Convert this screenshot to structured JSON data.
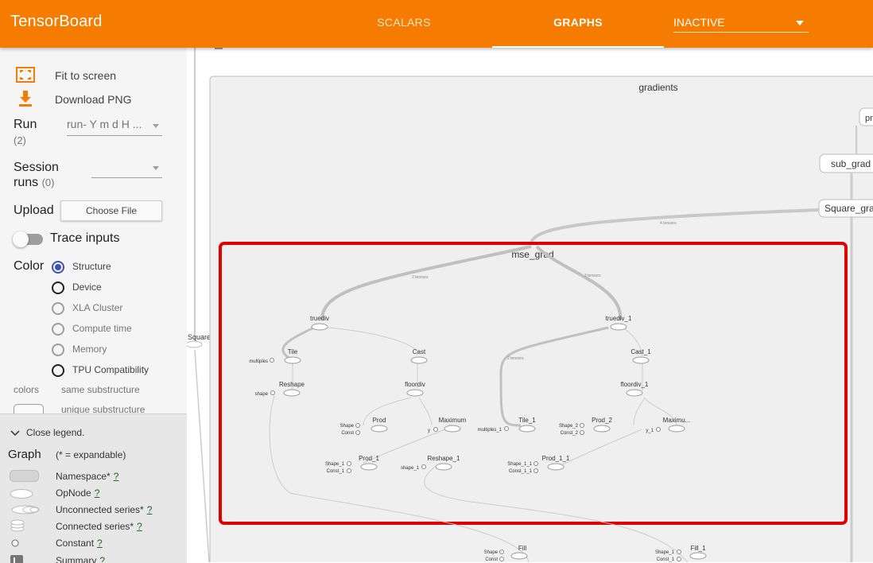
{
  "header": {
    "brand": "TensorBoard",
    "tabs": [
      {
        "label": "SCALARS",
        "active": false
      },
      {
        "label": "GRAPHS",
        "active": true
      }
    ],
    "run_selector": "INACTIVE"
  },
  "sidebar": {
    "fit_to_screen": "Fit to screen",
    "download_png": "Download PNG",
    "run_label": "Run",
    "run_count": "(2)",
    "run_value": "run- Y m d H ...",
    "session_label_1": "Session",
    "session_label_2": "runs",
    "session_count": "(0)",
    "upload_label": "Upload",
    "choose_file": "Choose File",
    "trace_inputs": "Trace inputs",
    "color_label": "Color",
    "color_options": [
      {
        "label": "Structure",
        "state": "selected"
      },
      {
        "label": "Device",
        "state": "enabled"
      },
      {
        "label": "XLA Cluster",
        "state": "disabled"
      },
      {
        "label": "Compute time",
        "state": "disabled"
      },
      {
        "label": "Memory",
        "state": "disabled"
      },
      {
        "label": "TPU Compatibility",
        "state": "enabled"
      }
    ],
    "colors_label": "colors",
    "same_substructure": "same substructure",
    "unique_substructure": "unique substructure"
  },
  "legend": {
    "close": "Close legend.",
    "graph_label": "Graph",
    "expandable_note": "(* = expandable)",
    "items": [
      {
        "label": "Namespace*",
        "help": "?"
      },
      {
        "label": "OpNode",
        "help": "?"
      },
      {
        "label": "Unconnected series*",
        "help": "?"
      },
      {
        "label": "Connected series*",
        "help": "?"
      },
      {
        "label": "Constant",
        "help": "?"
      },
      {
        "label": "Summary",
        "help": "?"
      }
    ]
  },
  "graph": {
    "namespace_title": "gradients",
    "highlight_title": "mse_grad",
    "square_label": "Square",
    "side_nodes": [
      "sub_grad",
      "Square_grad",
      "pre"
    ],
    "edge_labels": [
      "2 tensors",
      "4 tensors",
      "3 tensors",
      "2 tensors"
    ],
    "nodes": {
      "truediv": "truediv",
      "truediv_1": "truediv_1",
      "tile": "Tile",
      "cast": "Cast",
      "cast_1": "Cast_1",
      "reshape": "Reshape",
      "floordiv": "floordiv",
      "floordiv_1": "floordiv_1",
      "prod": "Prod",
      "maximum": "Maximum",
      "tile_1": "Tile_1",
      "prod_2": "Prod_2",
      "maximum_1": "Maximu...",
      "prod_1": "Prod_1",
      "reshape_1": "Reshape_1",
      "prod_1_1": "Prod_1_1",
      "fill": "Fill",
      "fill_1": "Fill_1"
    },
    "inputs": {
      "multiples": "multiples",
      "shape": "shape",
      "shape_c": "Shape",
      "const_c": "Const",
      "y": "y",
      "multiples_1": "multiples_1",
      "shape_2": "Shape_2",
      "const_2": "Const_2",
      "y_1": "y_1",
      "shape_1": "Shape_1",
      "const_1": "Const_1",
      "shape_1_r": "shape_1",
      "shape_1_1": "Shape_1_1",
      "const_1_1": "Const_1_1",
      "fill_shape": "Shape",
      "fill_const": "Const",
      "fill1_shape": "Shape_1",
      "fill1_const": "Const_1"
    },
    "highlight_color": "#e00000"
  }
}
